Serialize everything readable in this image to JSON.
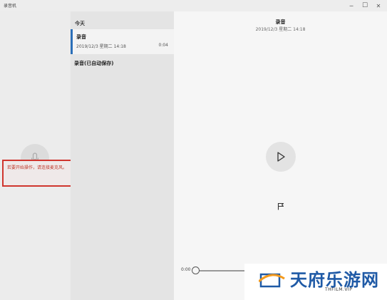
{
  "window": {
    "title": "录音机",
    "minimize_glyph": "─",
    "maximize_glyph": "☐",
    "close_glyph": "✕"
  },
  "left_panel": {
    "mic_icon": "microphone-icon",
    "hint": "若要开始操作，请连接麦克风。"
  },
  "recording_list": {
    "group_label": "今天",
    "items": [
      {
        "title": "录音",
        "date": "2019/12/3 星期二 14:18",
        "duration": "0:04",
        "selected": true
      },
      {
        "title": "录音(已自动保存)"
      }
    ]
  },
  "detail": {
    "title": "录音",
    "datetime": "2019/12/3 星期二 14:18",
    "play_icon": "play-icon",
    "flag_icon": "flag-icon"
  },
  "playback": {
    "current_time": "0:00",
    "progress": 0
  },
  "watermark": {
    "text": "天府乐游网",
    "subtext": "THFILM.VIP"
  },
  "colors": {
    "accent": "#2b6fb8",
    "hint_border": "#d0352e",
    "hint_text": "#c0392b",
    "watermark_blue": "#1f5aa6",
    "watermark_orange": "#f39a1e"
  }
}
